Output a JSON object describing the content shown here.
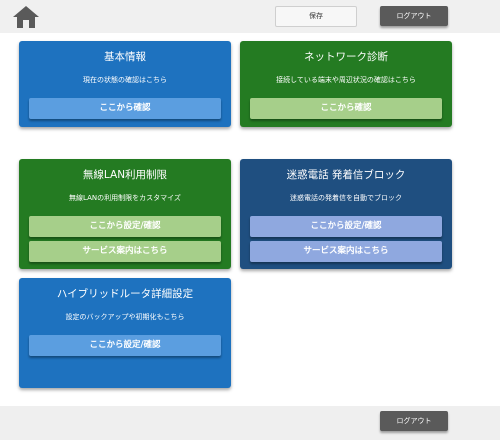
{
  "header": {
    "save_label": "保存",
    "logout_label": "ログアウト"
  },
  "footer": {
    "logout_label": "ログアウト"
  },
  "cards": [
    {
      "title": "基本情報",
      "desc": "現在の状態の確認はこちら",
      "buttons": [
        "ここから確認"
      ]
    },
    {
      "title": "ネットワーク診断",
      "desc": "接続している端末や周辺状況の確認はこちら",
      "buttons": [
        "ここから確認"
      ]
    },
    {
      "title": "無線LAN利用制限",
      "desc": "無線LANの利用制限をカスタマイズ",
      "buttons": [
        "ここから設定/確認",
        "サービス案内はこちら"
      ]
    },
    {
      "title": "迷惑電話 発着信ブロック",
      "desc": "迷惑電話の発着信を自動でブロック",
      "buttons": [
        "ここから設定/確認",
        "サービス案内はこちら"
      ]
    },
    {
      "title": "ハイブリッドルータ詳細設定",
      "desc": "設定のバックアップや初期化もこちら",
      "buttons": [
        "ここから設定/確認"
      ]
    }
  ],
  "colors": {
    "card_blue": "#1e72bf",
    "card_green": "#247b22",
    "card_navy": "#1f4f80",
    "button_dark": "#5a5a5a"
  }
}
